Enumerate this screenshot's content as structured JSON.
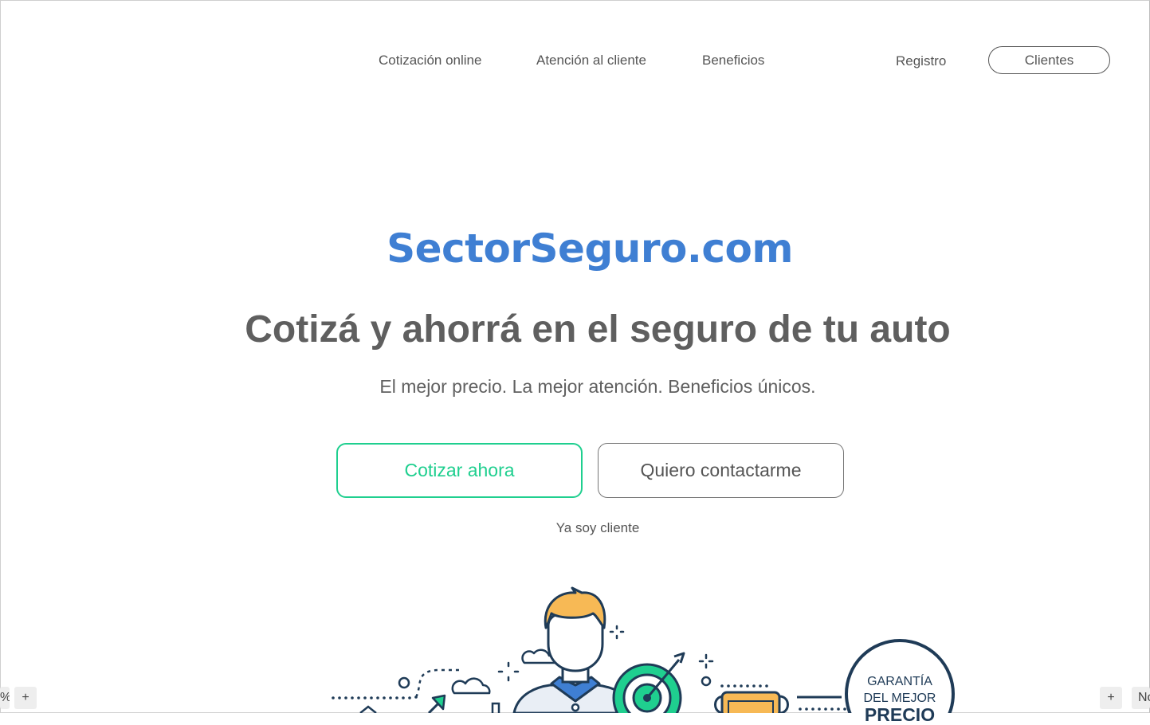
{
  "nav": {
    "items": [
      "Cotización online",
      "Atención al cliente",
      "Beneficios"
    ],
    "register_label": "Registro",
    "clients_label": "Clientes"
  },
  "hero": {
    "logo": "SectorSeguro.com",
    "headline": "Cotizá y ahorrá en el seguro de tu auto",
    "subtitle": "El mejor precio. La mejor atención. Beneficios únicos.",
    "primary_cta": "Cotizar ahora",
    "secondary_cta": "Quiero contactarme",
    "client_link": "Ya soy cliente"
  },
  "badge": {
    "line1": "GARANTÍA",
    "line2": "DEL MEJOR",
    "line3": "PRECIO"
  },
  "zoom": {
    "left_partial": "%",
    "plus": "+",
    "right_partial": "No"
  },
  "colors": {
    "brand_blue": "#3f7fd3",
    "accent_green": "#1fcf8f",
    "navy": "#1f3b57",
    "hair_orange": "#f7b955"
  }
}
